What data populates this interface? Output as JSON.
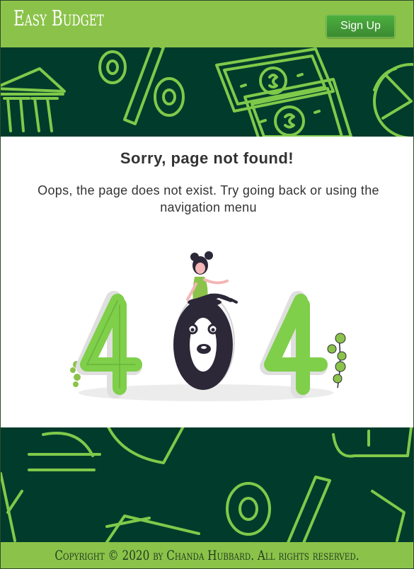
{
  "header": {
    "logo_text": "Easy Budget",
    "signup_label": "Sign Up"
  },
  "main": {
    "title": "Sorry, page not found!",
    "message": "Oops, the page does not exist. Try going back or using the navigation menu"
  },
  "footer": {
    "copyright": "Copyright © 2020 by Chanda Hubbard. All rights reserved."
  },
  "colors": {
    "brand_green": "#8bc34a",
    "dark_band": "#003b2b",
    "button_green": "#3b8a30",
    "text_dark": "#333333"
  },
  "icons": [
    "bank-icon",
    "percent-icon",
    "dollar-bill-icon",
    "pie-chart-icon",
    "euro-icon",
    "404-illustration"
  ]
}
